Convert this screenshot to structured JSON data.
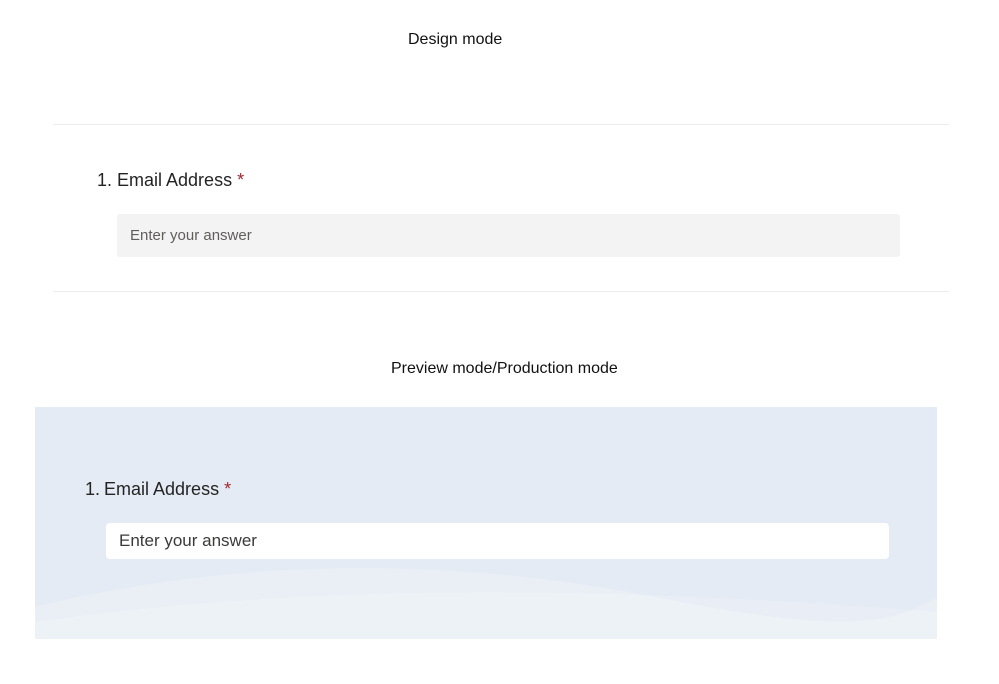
{
  "design_section": {
    "caption": "Design mode",
    "question": {
      "number": "1.",
      "label": "Email Address",
      "required_marker": "*",
      "placeholder": "Enter your answer"
    }
  },
  "preview_section": {
    "caption": "Preview mode/Production mode",
    "question": {
      "number": "1.",
      "label": "Email Address",
      "required_marker": "*",
      "placeholder": "Enter your answer"
    }
  },
  "colors": {
    "required_marker": "#a4262c",
    "preview_background": "#e5ebf4",
    "design_input_background": "#f3f3f3"
  }
}
